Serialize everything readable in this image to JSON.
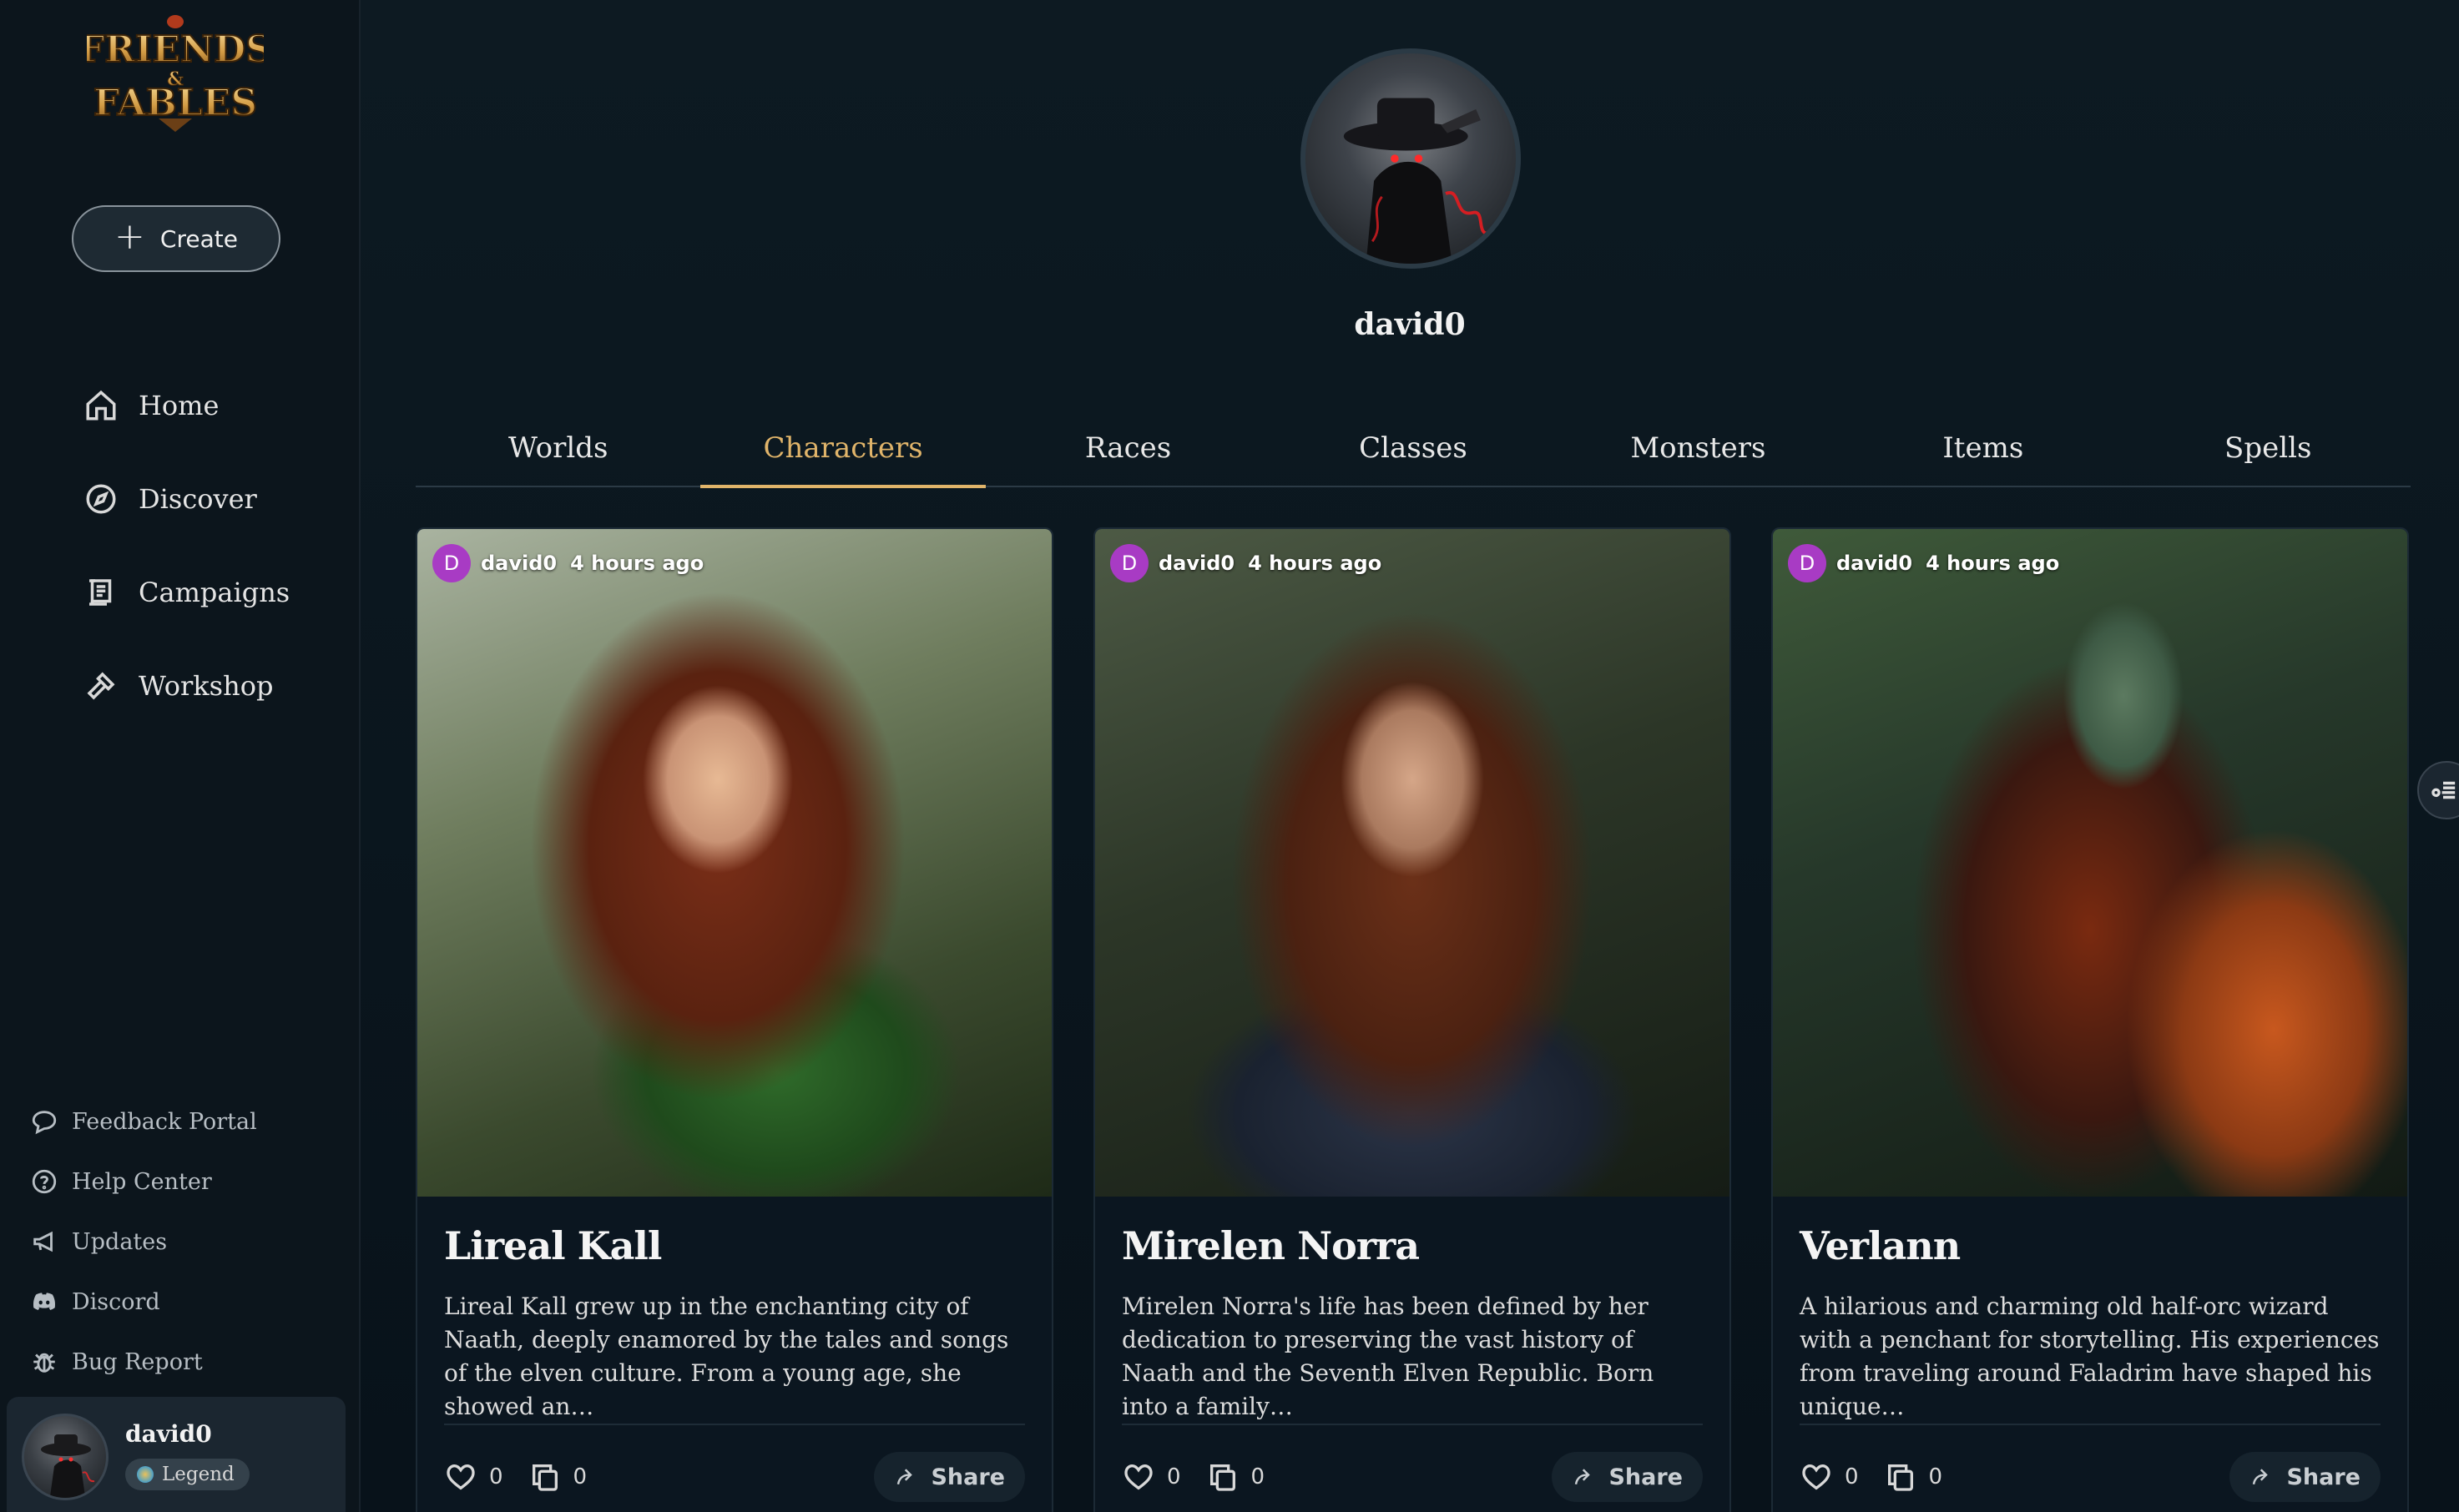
{
  "brand": {
    "logo_text_top": "FRIENDS",
    "logo_text_amp": "&",
    "logo_text_bottom": "FABLES",
    "gold": "#e0b46a"
  },
  "sidebar": {
    "create_label": "Create",
    "nav": [
      {
        "label": "Home",
        "icon": "home-icon"
      },
      {
        "label": "Discover",
        "icon": "compass-icon"
      },
      {
        "label": "Campaigns",
        "icon": "scroll-icon"
      },
      {
        "label": "Workshop",
        "icon": "hammer-icon"
      }
    ],
    "footer_links": [
      {
        "label": "Feedback Portal",
        "icon": "chat-bubble-icon"
      },
      {
        "label": "Help Center",
        "icon": "help-circle-icon"
      },
      {
        "label": "Updates",
        "icon": "megaphone-icon"
      },
      {
        "label": "Discord",
        "icon": "discord-icon"
      },
      {
        "label": "Bug Report",
        "icon": "bug-icon"
      }
    ],
    "user": {
      "name": "david0",
      "badge": "Legend"
    }
  },
  "profile": {
    "username": "david0"
  },
  "tabs": [
    {
      "label": "Worlds",
      "active": false
    },
    {
      "label": "Characters",
      "active": true
    },
    {
      "label": "Races",
      "active": false
    },
    {
      "label": "Classes",
      "active": false
    },
    {
      "label": "Monsters",
      "active": false
    },
    {
      "label": "Items",
      "active": false
    },
    {
      "label": "Spells",
      "active": false
    }
  ],
  "cards": [
    {
      "author_initial": "D",
      "author": "david0",
      "time": "4 hours ago",
      "title": "Lireal Kall",
      "description": "Lireal Kall grew up in the enchanting city of Naath, deeply enamored by the tales and songs of the elven culture. From a young age, she showed an…",
      "likes": "0",
      "copies": "0",
      "share_label": "Share"
    },
    {
      "author_initial": "D",
      "author": "david0",
      "time": "4 hours ago",
      "title": "Mirelen Norra",
      "description": "Mirelen Norra's life has been defined by her dedication to preserving the vast history of Naath and the Seventh Elven Republic. Born into a family…",
      "likes": "0",
      "copies": "0",
      "share_label": "Share"
    },
    {
      "author_initial": "D",
      "author": "david0",
      "time": "4 hours ago",
      "title": "Verlann",
      "description": "A hilarious and charming old half-orc wizard with a penchant for storytelling. His experiences from traveling around Faladrim have shaped his unique…",
      "likes": "0",
      "copies": "0",
      "share_label": "Share"
    }
  ]
}
